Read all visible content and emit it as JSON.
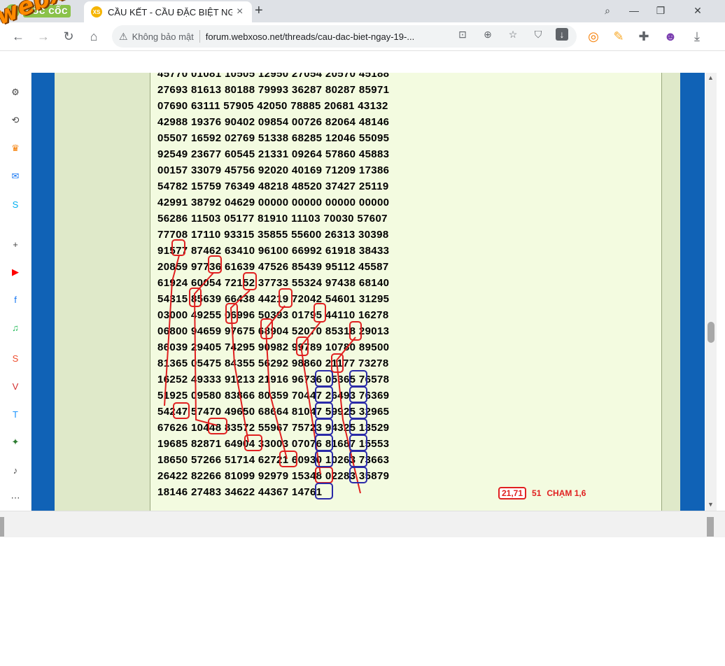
{
  "browser": {
    "brand": "cốc cốc",
    "tab_title": "CẦU KẾT - CẦU ĐẶC BIỆT NG",
    "tab_favicon": "XS",
    "close_tab": "×",
    "new_tab": "+",
    "security_label": "Không bảo mật",
    "url": "forum.webxoso.net/threads/cau-dac-biet-ngay-19-...",
    "watermark": "webxoso.net"
  },
  "sidebar": {
    "items": [
      {
        "name": "settings-icon",
        "glyph": "⚙",
        "color": "#444444"
      },
      {
        "name": "history-icon",
        "glyph": "⟲",
        "color": "#444444"
      },
      {
        "name": "crown-icon",
        "glyph": "♛",
        "color": "#f57c00"
      },
      {
        "name": "messenger-icon",
        "glyph": "✉",
        "color": "#1877f2"
      },
      {
        "name": "skype-icon",
        "glyph": "S",
        "color": "#00aff0"
      },
      {
        "name": "add-icon",
        "glyph": "+",
        "color": "#444444"
      },
      {
        "name": "youtube-icon",
        "glyph": "▶",
        "color": "#ff0000"
      },
      {
        "name": "facebook-icon",
        "glyph": "f",
        "color": "#1877f2"
      },
      {
        "name": "spotify-icon",
        "glyph": "♫",
        "color": "#1db954"
      },
      {
        "name": "shopee-icon",
        "glyph": "S",
        "color": "#ee4d2d"
      },
      {
        "name": "vtv-icon",
        "glyph": "V",
        "color": "#d32f2f"
      },
      {
        "name": "tiki-icon",
        "glyph": "T",
        "color": "#1a94ff"
      },
      {
        "name": "graduation-icon",
        "glyph": "✦",
        "color": "#2e7d32"
      },
      {
        "name": "notification-bell-icon",
        "glyph": "♪",
        "color": "#444444"
      },
      {
        "name": "more-icon",
        "glyph": "⋯",
        "color": "#444444"
      }
    ]
  },
  "post": {
    "rows": [
      "45770 01081 10505 12950 27054 20570 45188",
      "27693 81613 80188 79993 36287 80287 85971",
      "07690 63111 57905 42050 78885 20681 43132",
      "42988 19376 90402 09854 00726 82064 48146",
      "05507 16592 02769 51338 68285 12046 55095",
      "92549 23677 60545 21331 09264 57860 45883",
      "00157 33079 45756 92020 40169 71209 17386",
      "54782 15759 76349 48218 48520 37427 25119",
      "42991 38792 04629 00000 00000 00000 00000",
      "56286 11503 05177 81910 11103 70030 57607",
      "77708 17110 93315 35855 55600 26313 30398",
      "91577 87462 63410 96100 66992 61918 38433",
      "20859 97736 61639 47526 85439 95112 45587",
      "61924 60054 72152 37733 55324 97438 68140",
      "54315 85639 66438 44219 72042 54601 31295",
      "03000 49255 06996 50393 01795 44110 16278",
      "06800 94659 97675 68904 52070 85318 29013",
      "86039 29405 74295 90982 99789 10780 89500",
      "81365 05475 84355 56292 98860 21177 73278",
      "16252 49333 91213 21916 96736 05365 76578",
      "51925 09580 83866 80359 70447 26493 76369",
      "54247 57470 49650 68664 81047 59925 32965",
      "67626 10448 83572 55967 75723 94325 13529",
      "19685 82871 64904 33003 07076 81687 15553",
      "18650 57266 51714 62721 60930 10263 73663",
      "26422 82266 81099 92979 15348 02283 35879",
      "18146 27483 34622 44367 14761"
    ],
    "prediction": "21,71",
    "extra_number": "51",
    "note": "CHẠM 1,6"
  },
  "highlights": {
    "red_color": "#e02020",
    "blue_color": "#2a2aa8"
  }
}
